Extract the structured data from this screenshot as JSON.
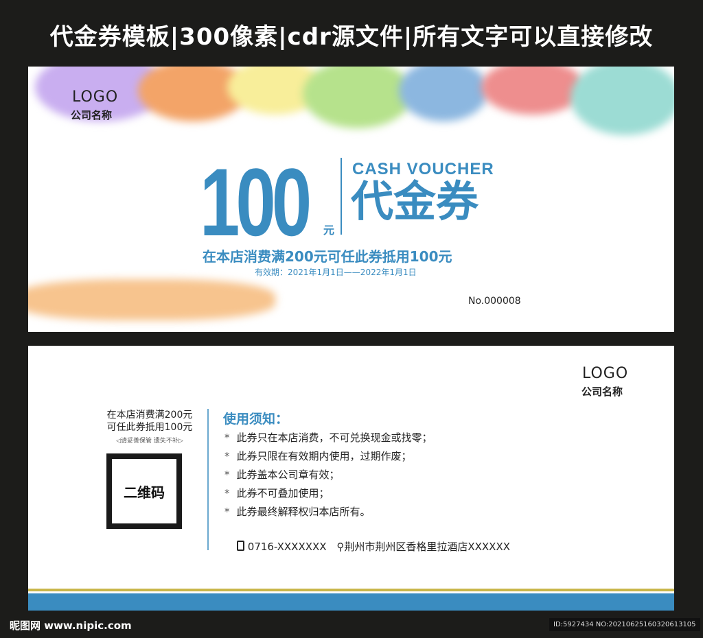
{
  "banner_title": "代金券模板|300像素|cdr源文件|所有文字可以直接修改",
  "front": {
    "logo": "LOGO",
    "company": "公司名称",
    "amount": "100",
    "unit": "元",
    "english": "CASH VOUCHER",
    "chinese": "代金券",
    "offer": "在本店消费满200元可任此券抵用100元",
    "validity": "有效期：2021年1月1日——2022年1月1日",
    "serial": "No.000008"
  },
  "back": {
    "logo": "LOGO",
    "company": "公司名称",
    "offer_line1": "在本店消费满200元",
    "offer_line2": "可任此券抵用100元",
    "keep_note": "◁请妥善保管  遗失不补▷",
    "qr_label": "二维码",
    "notice_title": "使用须知：",
    "rules": [
      "此券只在本店消费，不可兑换现金或找零；",
      "此券只限在有效期内使用，过期作废；",
      "此券盖本公司章有效；",
      "此券不可叠加使用；",
      "此券最终解释权归本店所有。"
    ],
    "phone": "0716-XXXXXXX",
    "address": "荆州市荆州区香格里拉酒店XXXXXX"
  },
  "watermark": {
    "site": "昵图网 www.nipic.com",
    "id": "ID:5927434 NO:20210625160320613105"
  },
  "colors": {
    "accent": "#3a8cc0",
    "band": "#3a8cc0",
    "stripe": "#c9b64a"
  }
}
